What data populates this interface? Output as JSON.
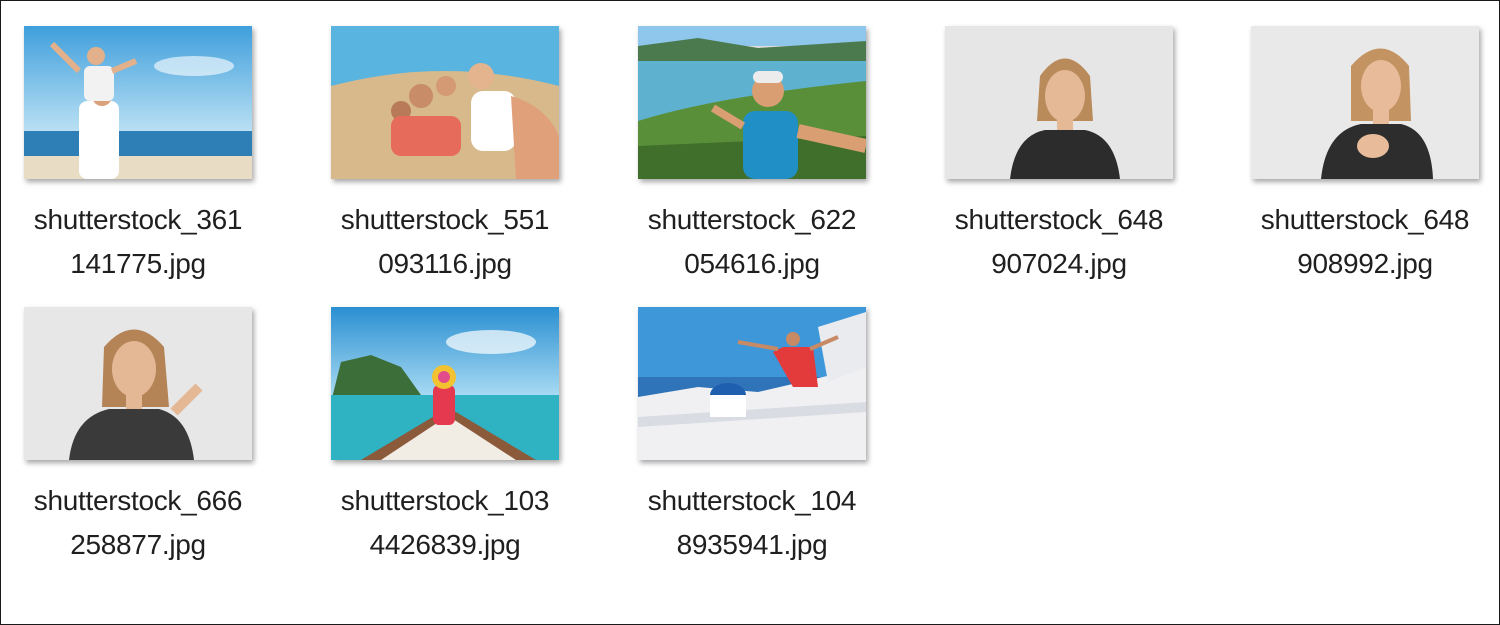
{
  "files": [
    {
      "line1": "shutterstock_361",
      "line2": "141775.jpg"
    },
    {
      "line1": "shutterstock_551",
      "line2": "093116.jpg"
    },
    {
      "line1": "shutterstock_622",
      "line2": "054616.jpg"
    },
    {
      "line1": "shutterstock_648",
      "line2": "907024.jpg"
    },
    {
      "line1": "shutterstock_648",
      "line2": "908992.jpg"
    },
    {
      "line1": "shutterstock_666",
      "line2": "258877.jpg"
    },
    {
      "line1": "shutterstock_103",
      "line2": "4426839.jpg"
    },
    {
      "line1": "shutterstock_104",
      "line2": "8935941.jpg"
    }
  ]
}
